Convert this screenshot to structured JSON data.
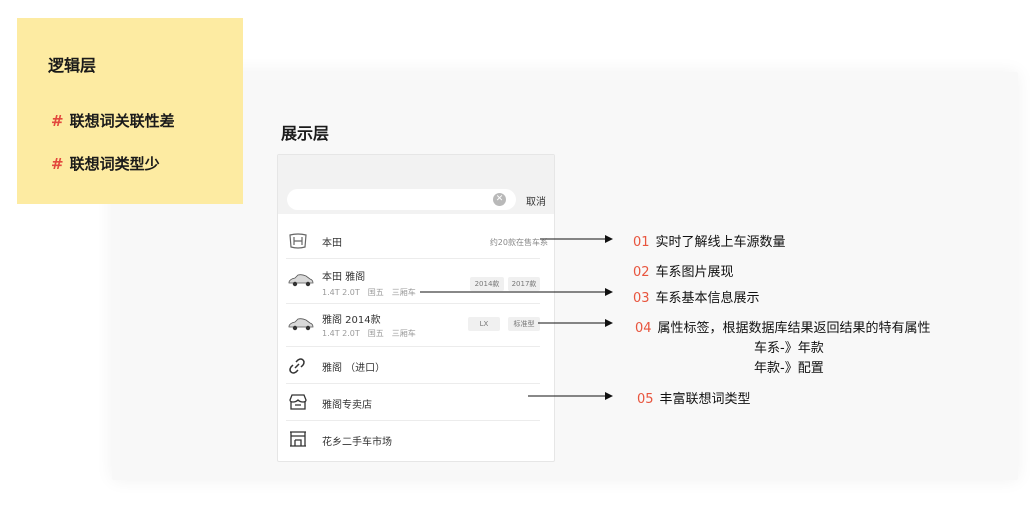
{
  "logic_note": {
    "title": "逻辑层",
    "items": [
      {
        "hash": "#",
        "text": "联想词关联性差"
      },
      {
        "hash": "#",
        "text": "联想词类型少"
      }
    ]
  },
  "display_title": "展示层",
  "phone": {
    "search": {
      "placeholder": "",
      "clear_icon": "clear-circle-icon"
    },
    "cancel_label": "取消",
    "rows": [
      {
        "icon": "honda-logo-icon",
        "name": "本田",
        "note": "约20款在售车系"
      },
      {
        "icon": "car-thumbnail-icon",
        "name": "本田 雅阁",
        "sub": [
          "1.4T 2.0T",
          "国五",
          "三厢车"
        ],
        "tags": [
          "2014款",
          "2017款"
        ]
      },
      {
        "icon": "car-thumbnail-icon",
        "name": "雅阁 2014款",
        "sub": [
          "1.4T 2.0T",
          "国五",
          "三厢车"
        ],
        "tags": [
          "LX",
          "标准型"
        ]
      },
      {
        "icon": "link-icon",
        "name": "雅阁 （进口）"
      },
      {
        "icon": "store-icon",
        "name": "雅阁专卖店"
      },
      {
        "icon": "market-icon",
        "name": "花乡二手车市场"
      }
    ]
  },
  "annotations": [
    {
      "num": "01",
      "text": "实时了解线上车源数量"
    },
    {
      "num": "02",
      "text": "车系图片展现"
    },
    {
      "num": "03",
      "text": "车系基本信息展示"
    },
    {
      "num": "04",
      "text": "属性标签，根据数据库结果返回结果的特有属性",
      "extra": [
        "车系-》年款",
        "年款-》配置"
      ]
    },
    {
      "num": "05",
      "text": "丰富联想词类型"
    }
  ],
  "colors": {
    "accent": "#e8553e",
    "note_bg": "#fdeba2",
    "hash": "#e2483d"
  }
}
